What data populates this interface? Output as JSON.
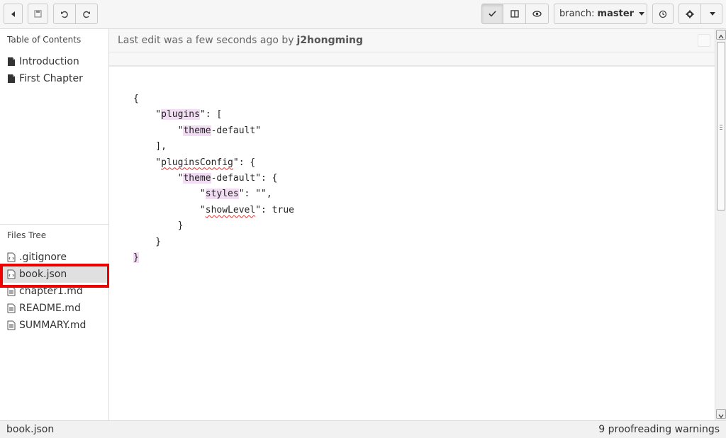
{
  "toolbar": {
    "branch_prefix": "branch:",
    "branch_name": "master",
    "icons": [
      "back-icon",
      "save-icon",
      "undo-icon",
      "redo-icon",
      "check-icon",
      "columns-icon",
      "eye-icon",
      "branch-icon",
      "history-icon",
      "gear-icon",
      "caret-down-icon"
    ]
  },
  "sidebar": {
    "toc_title": "Table of Contents",
    "toc_items": [
      {
        "label": "Introduction"
      },
      {
        "label": "First Chapter"
      }
    ],
    "files_title": "Files Tree",
    "files": [
      {
        "label": ".gitignore"
      },
      {
        "label": "book.json"
      },
      {
        "label": "chapter1.md"
      },
      {
        "label": "README.md"
      },
      {
        "label": "SUMMARY.md"
      }
    ]
  },
  "editor": {
    "last_edit_text": "Last edit was a few seconds ago by",
    "last_edit_user": "j2hongming",
    "lines": {
      "l1": "{",
      "l2a": "    \"",
      "l2k": "plugins",
      "l2b": "\": [",
      "l3a": "        \"",
      "l3k": "theme",
      "l3b": "-default\"",
      "l4": "    ],",
      "l5a": "    \"",
      "l5k": "pluginsConfig",
      "l5b": "\": {",
      "l6a": "        \"",
      "l6k": "theme",
      "l6b": "-default\": {",
      "l7a": "            \"",
      "l7k": "styles",
      "l7b": "\": \"\",",
      "l8a": "            \"",
      "l8k": "showLevel",
      "l8b": "\": true",
      "l9": "        }",
      "l10": "    }",
      "l11": "}"
    }
  },
  "status": {
    "file_name": "book.json",
    "warnings": "9 proofreading warnings"
  },
  "colors": {
    "highlight_border": "#ee0000",
    "keyword_bg": "#f2dcf3",
    "selected_row": "#e0e0e0"
  }
}
